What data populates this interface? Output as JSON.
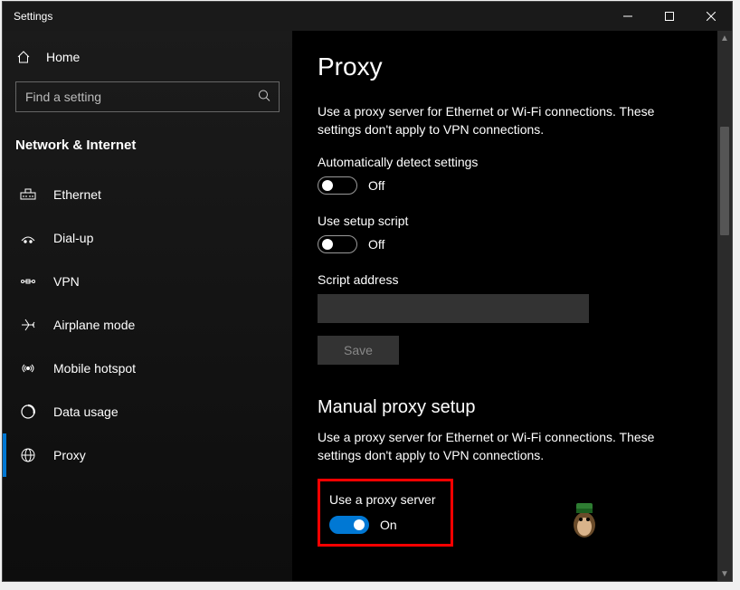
{
  "window": {
    "title": "Settings"
  },
  "sidebar": {
    "home": "Home",
    "search_placeholder": "Find a setting",
    "category": "Network & Internet",
    "items": [
      {
        "label": "Ethernet",
        "icon": "ethernet-icon"
      },
      {
        "label": "Dial-up",
        "icon": "dialup-icon"
      },
      {
        "label": "VPN",
        "icon": "vpn-icon"
      },
      {
        "label": "Airplane mode",
        "icon": "airplane-icon"
      },
      {
        "label": "Mobile hotspot",
        "icon": "hotspot-icon"
      },
      {
        "label": "Data usage",
        "icon": "datausage-icon"
      },
      {
        "label": "Proxy",
        "icon": "proxy-icon"
      }
    ]
  },
  "page": {
    "title": "Proxy",
    "intro": "Use a proxy server for Ethernet or Wi-Fi connections. These settings don't apply to VPN connections.",
    "auto_detect": {
      "label": "Automatically detect settings",
      "state": "Off"
    },
    "setup_script": {
      "label": "Use setup script",
      "state": "Off"
    },
    "script_address": {
      "label": "Script address",
      "value": ""
    },
    "save": "Save",
    "manual": {
      "heading": "Manual proxy setup",
      "intro": "Use a proxy server for Ethernet or Wi-Fi connections. These settings don't apply to VPN connections.",
      "use_proxy": {
        "label": "Use a proxy server",
        "state": "On"
      }
    }
  }
}
